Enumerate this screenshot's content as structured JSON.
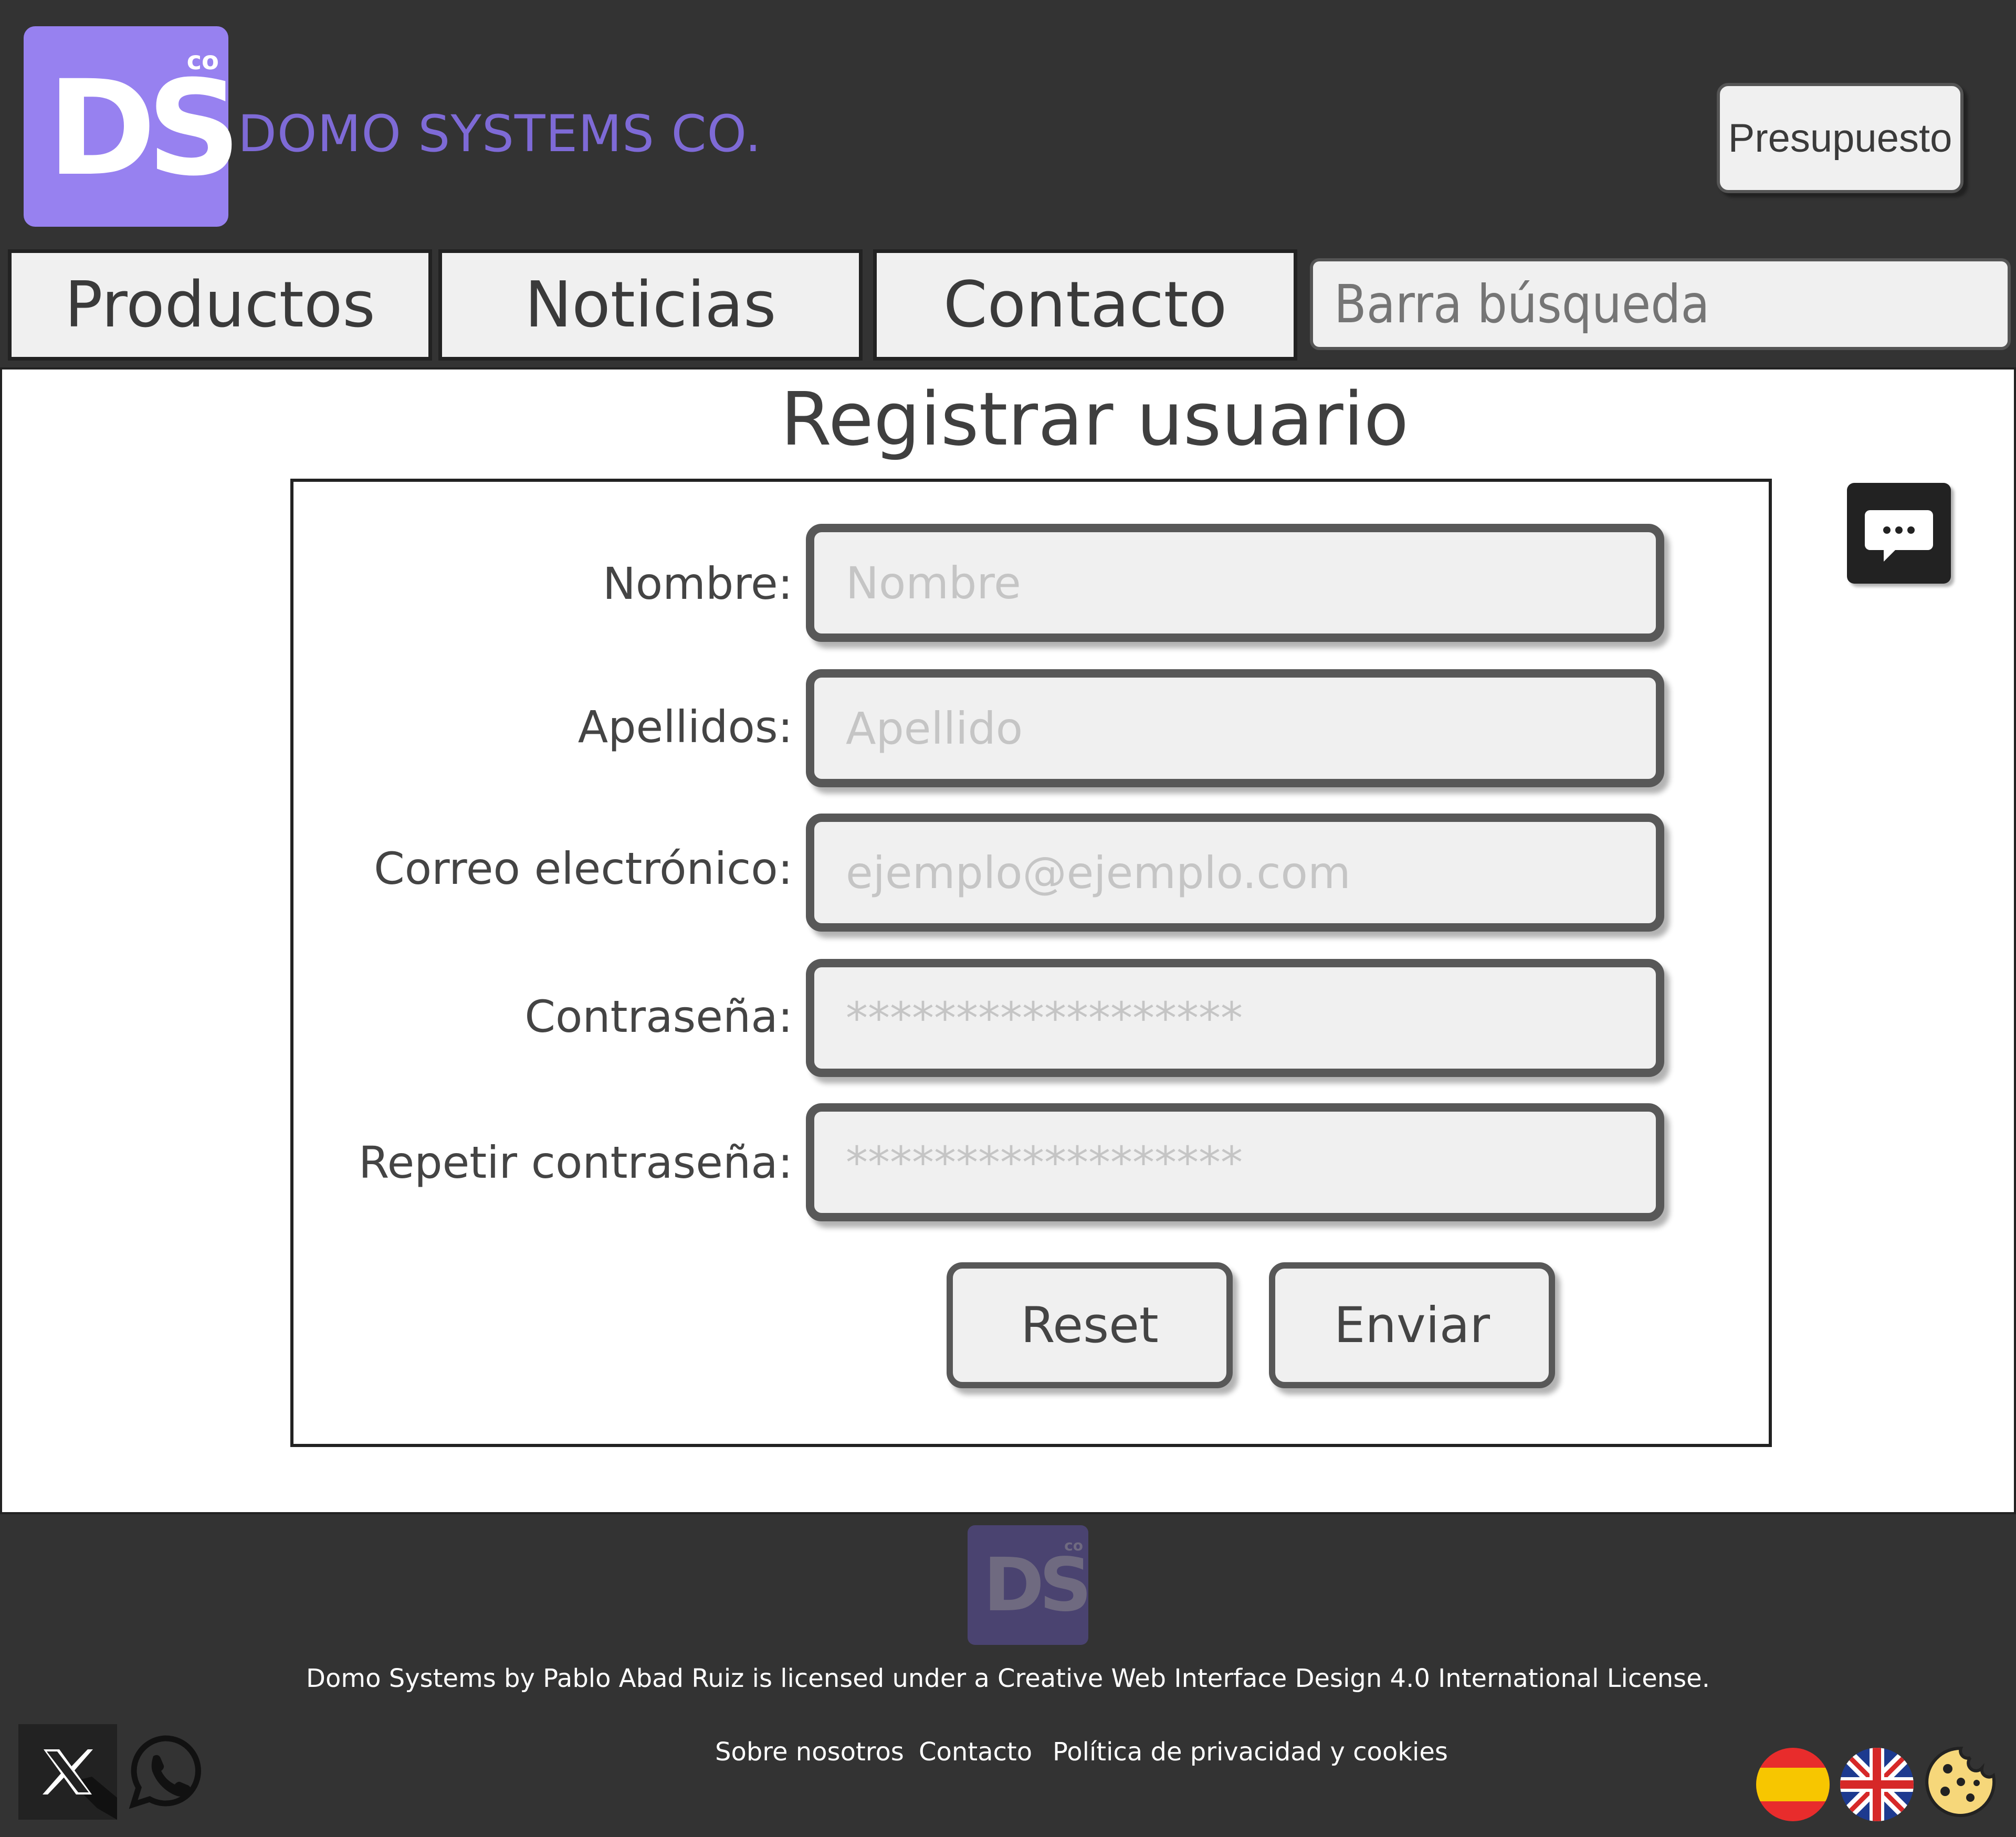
{
  "header": {
    "logo_main": "DS",
    "logo_sup": "co",
    "brand": "DOMO SYSTEMS CO.",
    "budget_button": "Presupuesto"
  },
  "nav": {
    "tabs": [
      {
        "label": "Productos"
      },
      {
        "label": "Noticias"
      },
      {
        "label": "Contacto"
      }
    ],
    "search_placeholder": "Barra búsqueda"
  },
  "main": {
    "title": "Registrar usuario",
    "fields": [
      {
        "label": "Nombre:",
        "placeholder": "Nombre"
      },
      {
        "label": "Apellidos:",
        "placeholder": "Apellido"
      },
      {
        "label": "Correo electrónico:",
        "placeholder": "ejemplo@ejemplo.com"
      },
      {
        "label": "Contraseña:",
        "placeholder": "******************"
      },
      {
        "label": "Repetir contraseña:",
        "placeholder": "******************"
      }
    ],
    "reset_button": "Reset",
    "submit_button": "Enviar",
    "chat_icon": "chat-icon"
  },
  "footer": {
    "logo_main": "DS",
    "logo_sup": "co",
    "license": "Domo Systems by Pablo Abad Ruiz is licensed under a Creative Web Interface Design 4.0 International License.",
    "links": [
      "Sobre nosotros",
      "Contacto",
      "Política de privacidad y cookies"
    ],
    "icons": [
      "x-icon",
      "whatsapp-icon",
      "spain-flag-icon",
      "uk-flag-icon",
      "cookie-icon"
    ]
  },
  "colors": {
    "background": "#333333",
    "brand": "#9781f0",
    "brand_text": "#7e6ad6",
    "panel": "#ffffff",
    "control": "#f0f0f0"
  }
}
